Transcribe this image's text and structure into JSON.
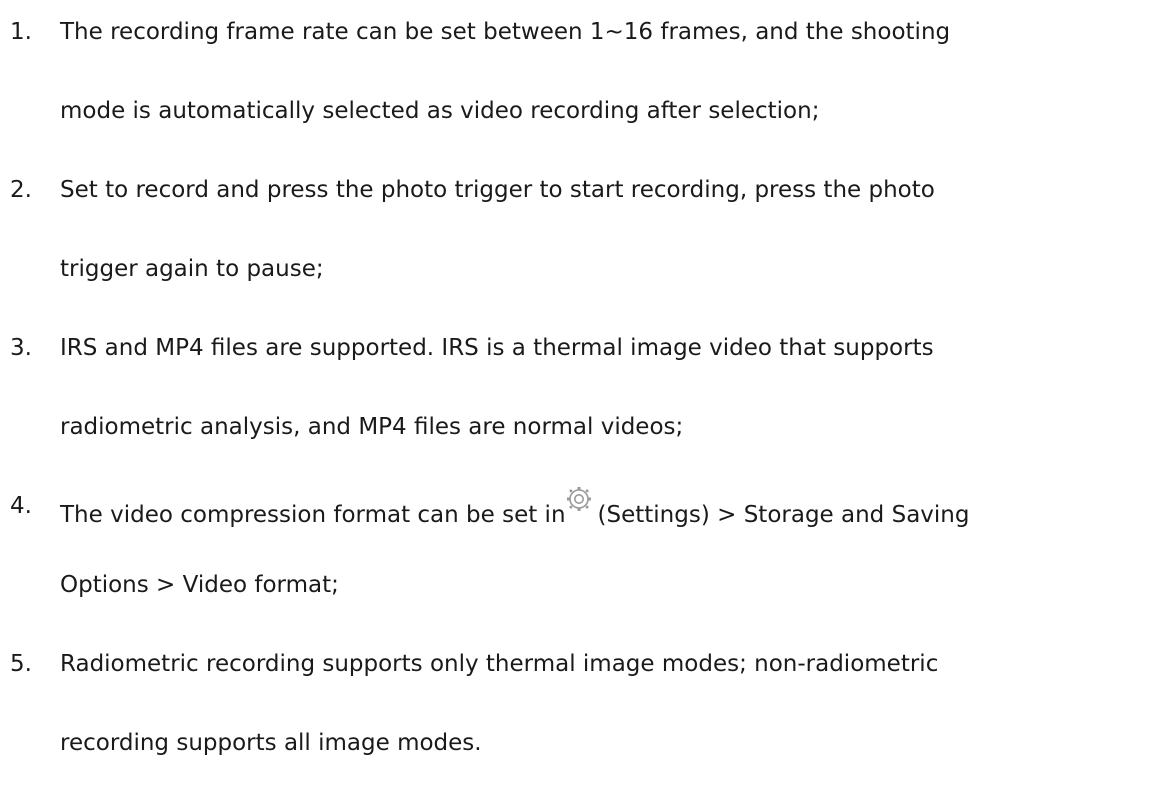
{
  "items": [
    {
      "number": "1.",
      "line1": "The recording frame rate can be set between 1~16 frames, and the shooting",
      "line2": "mode is automatically selected as video recording after selection;"
    },
    {
      "number": "2.",
      "line1": "Set to record and press the photo trigger to start recording, press the photo",
      "line2": "trigger again to pause;"
    },
    {
      "number": "3.",
      "line1": "IRS and MP4 files are supported. IRS is a thermal image video that supports",
      "line2": "radiometric analysis, and MP4 files are normal videos;"
    },
    {
      "number": "4.",
      "line1_before_icon": "The video compression format can be set in",
      "icon": "settings-gear-icon",
      "line1_after_icon": "(Settings) > Storage and Saving",
      "line2": "Options > Video format;"
    },
    {
      "number": "5.",
      "line1": "Radiometric recording supports only thermal image modes; non-radiometric",
      "line2": "recording supports all image modes."
    }
  ]
}
